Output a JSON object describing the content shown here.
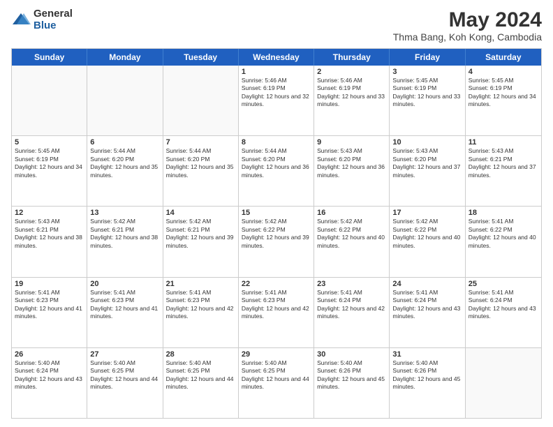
{
  "header": {
    "logo_general": "General",
    "logo_blue": "Blue",
    "month_year": "May 2024",
    "location": "Thma Bang, Koh Kong, Cambodia"
  },
  "days_of_week": [
    "Sunday",
    "Monday",
    "Tuesday",
    "Wednesday",
    "Thursday",
    "Friday",
    "Saturday"
  ],
  "weeks": [
    [
      {
        "day": "",
        "empty": true
      },
      {
        "day": "",
        "empty": true
      },
      {
        "day": "",
        "empty": true
      },
      {
        "day": "1",
        "sunrise": "5:46 AM",
        "sunset": "6:19 PM",
        "daylight": "12 hours and 32 minutes."
      },
      {
        "day": "2",
        "sunrise": "5:46 AM",
        "sunset": "6:19 PM",
        "daylight": "12 hours and 33 minutes."
      },
      {
        "day": "3",
        "sunrise": "5:45 AM",
        "sunset": "6:19 PM",
        "daylight": "12 hours and 33 minutes."
      },
      {
        "day": "4",
        "sunrise": "5:45 AM",
        "sunset": "6:19 PM",
        "daylight": "12 hours and 34 minutes."
      }
    ],
    [
      {
        "day": "5",
        "sunrise": "5:45 AM",
        "sunset": "6:19 PM",
        "daylight": "12 hours and 34 minutes."
      },
      {
        "day": "6",
        "sunrise": "5:44 AM",
        "sunset": "6:20 PM",
        "daylight": "12 hours and 35 minutes."
      },
      {
        "day": "7",
        "sunrise": "5:44 AM",
        "sunset": "6:20 PM",
        "daylight": "12 hours and 35 minutes."
      },
      {
        "day": "8",
        "sunrise": "5:44 AM",
        "sunset": "6:20 PM",
        "daylight": "12 hours and 36 minutes."
      },
      {
        "day": "9",
        "sunrise": "5:43 AM",
        "sunset": "6:20 PM",
        "daylight": "12 hours and 36 minutes."
      },
      {
        "day": "10",
        "sunrise": "5:43 AM",
        "sunset": "6:20 PM",
        "daylight": "12 hours and 37 minutes."
      },
      {
        "day": "11",
        "sunrise": "5:43 AM",
        "sunset": "6:21 PM",
        "daylight": "12 hours and 37 minutes."
      }
    ],
    [
      {
        "day": "12",
        "sunrise": "5:43 AM",
        "sunset": "6:21 PM",
        "daylight": "12 hours and 38 minutes."
      },
      {
        "day": "13",
        "sunrise": "5:42 AM",
        "sunset": "6:21 PM",
        "daylight": "12 hours and 38 minutes."
      },
      {
        "day": "14",
        "sunrise": "5:42 AM",
        "sunset": "6:21 PM",
        "daylight": "12 hours and 39 minutes."
      },
      {
        "day": "15",
        "sunrise": "5:42 AM",
        "sunset": "6:22 PM",
        "daylight": "12 hours and 39 minutes."
      },
      {
        "day": "16",
        "sunrise": "5:42 AM",
        "sunset": "6:22 PM",
        "daylight": "12 hours and 40 minutes."
      },
      {
        "day": "17",
        "sunrise": "5:42 AM",
        "sunset": "6:22 PM",
        "daylight": "12 hours and 40 minutes."
      },
      {
        "day": "18",
        "sunrise": "5:41 AM",
        "sunset": "6:22 PM",
        "daylight": "12 hours and 40 minutes."
      }
    ],
    [
      {
        "day": "19",
        "sunrise": "5:41 AM",
        "sunset": "6:23 PM",
        "daylight": "12 hours and 41 minutes."
      },
      {
        "day": "20",
        "sunrise": "5:41 AM",
        "sunset": "6:23 PM",
        "daylight": "12 hours and 41 minutes."
      },
      {
        "day": "21",
        "sunrise": "5:41 AM",
        "sunset": "6:23 PM",
        "daylight": "12 hours and 42 minutes."
      },
      {
        "day": "22",
        "sunrise": "5:41 AM",
        "sunset": "6:23 PM",
        "daylight": "12 hours and 42 minutes."
      },
      {
        "day": "23",
        "sunrise": "5:41 AM",
        "sunset": "6:24 PM",
        "daylight": "12 hours and 42 minutes."
      },
      {
        "day": "24",
        "sunrise": "5:41 AM",
        "sunset": "6:24 PM",
        "daylight": "12 hours and 43 minutes."
      },
      {
        "day": "25",
        "sunrise": "5:41 AM",
        "sunset": "6:24 PM",
        "daylight": "12 hours and 43 minutes."
      }
    ],
    [
      {
        "day": "26",
        "sunrise": "5:40 AM",
        "sunset": "6:24 PM",
        "daylight": "12 hours and 43 minutes."
      },
      {
        "day": "27",
        "sunrise": "5:40 AM",
        "sunset": "6:25 PM",
        "daylight": "12 hours and 44 minutes."
      },
      {
        "day": "28",
        "sunrise": "5:40 AM",
        "sunset": "6:25 PM",
        "daylight": "12 hours and 44 minutes."
      },
      {
        "day": "29",
        "sunrise": "5:40 AM",
        "sunset": "6:25 PM",
        "daylight": "12 hours and 44 minutes."
      },
      {
        "day": "30",
        "sunrise": "5:40 AM",
        "sunset": "6:26 PM",
        "daylight": "12 hours and 45 minutes."
      },
      {
        "day": "31",
        "sunrise": "5:40 AM",
        "sunset": "6:26 PM",
        "daylight": "12 hours and 45 minutes."
      },
      {
        "day": "",
        "empty": true
      }
    ]
  ],
  "labels": {
    "sunrise_prefix": "Sunrise: ",
    "sunset_prefix": "Sunset: ",
    "daylight_prefix": "Daylight: "
  }
}
